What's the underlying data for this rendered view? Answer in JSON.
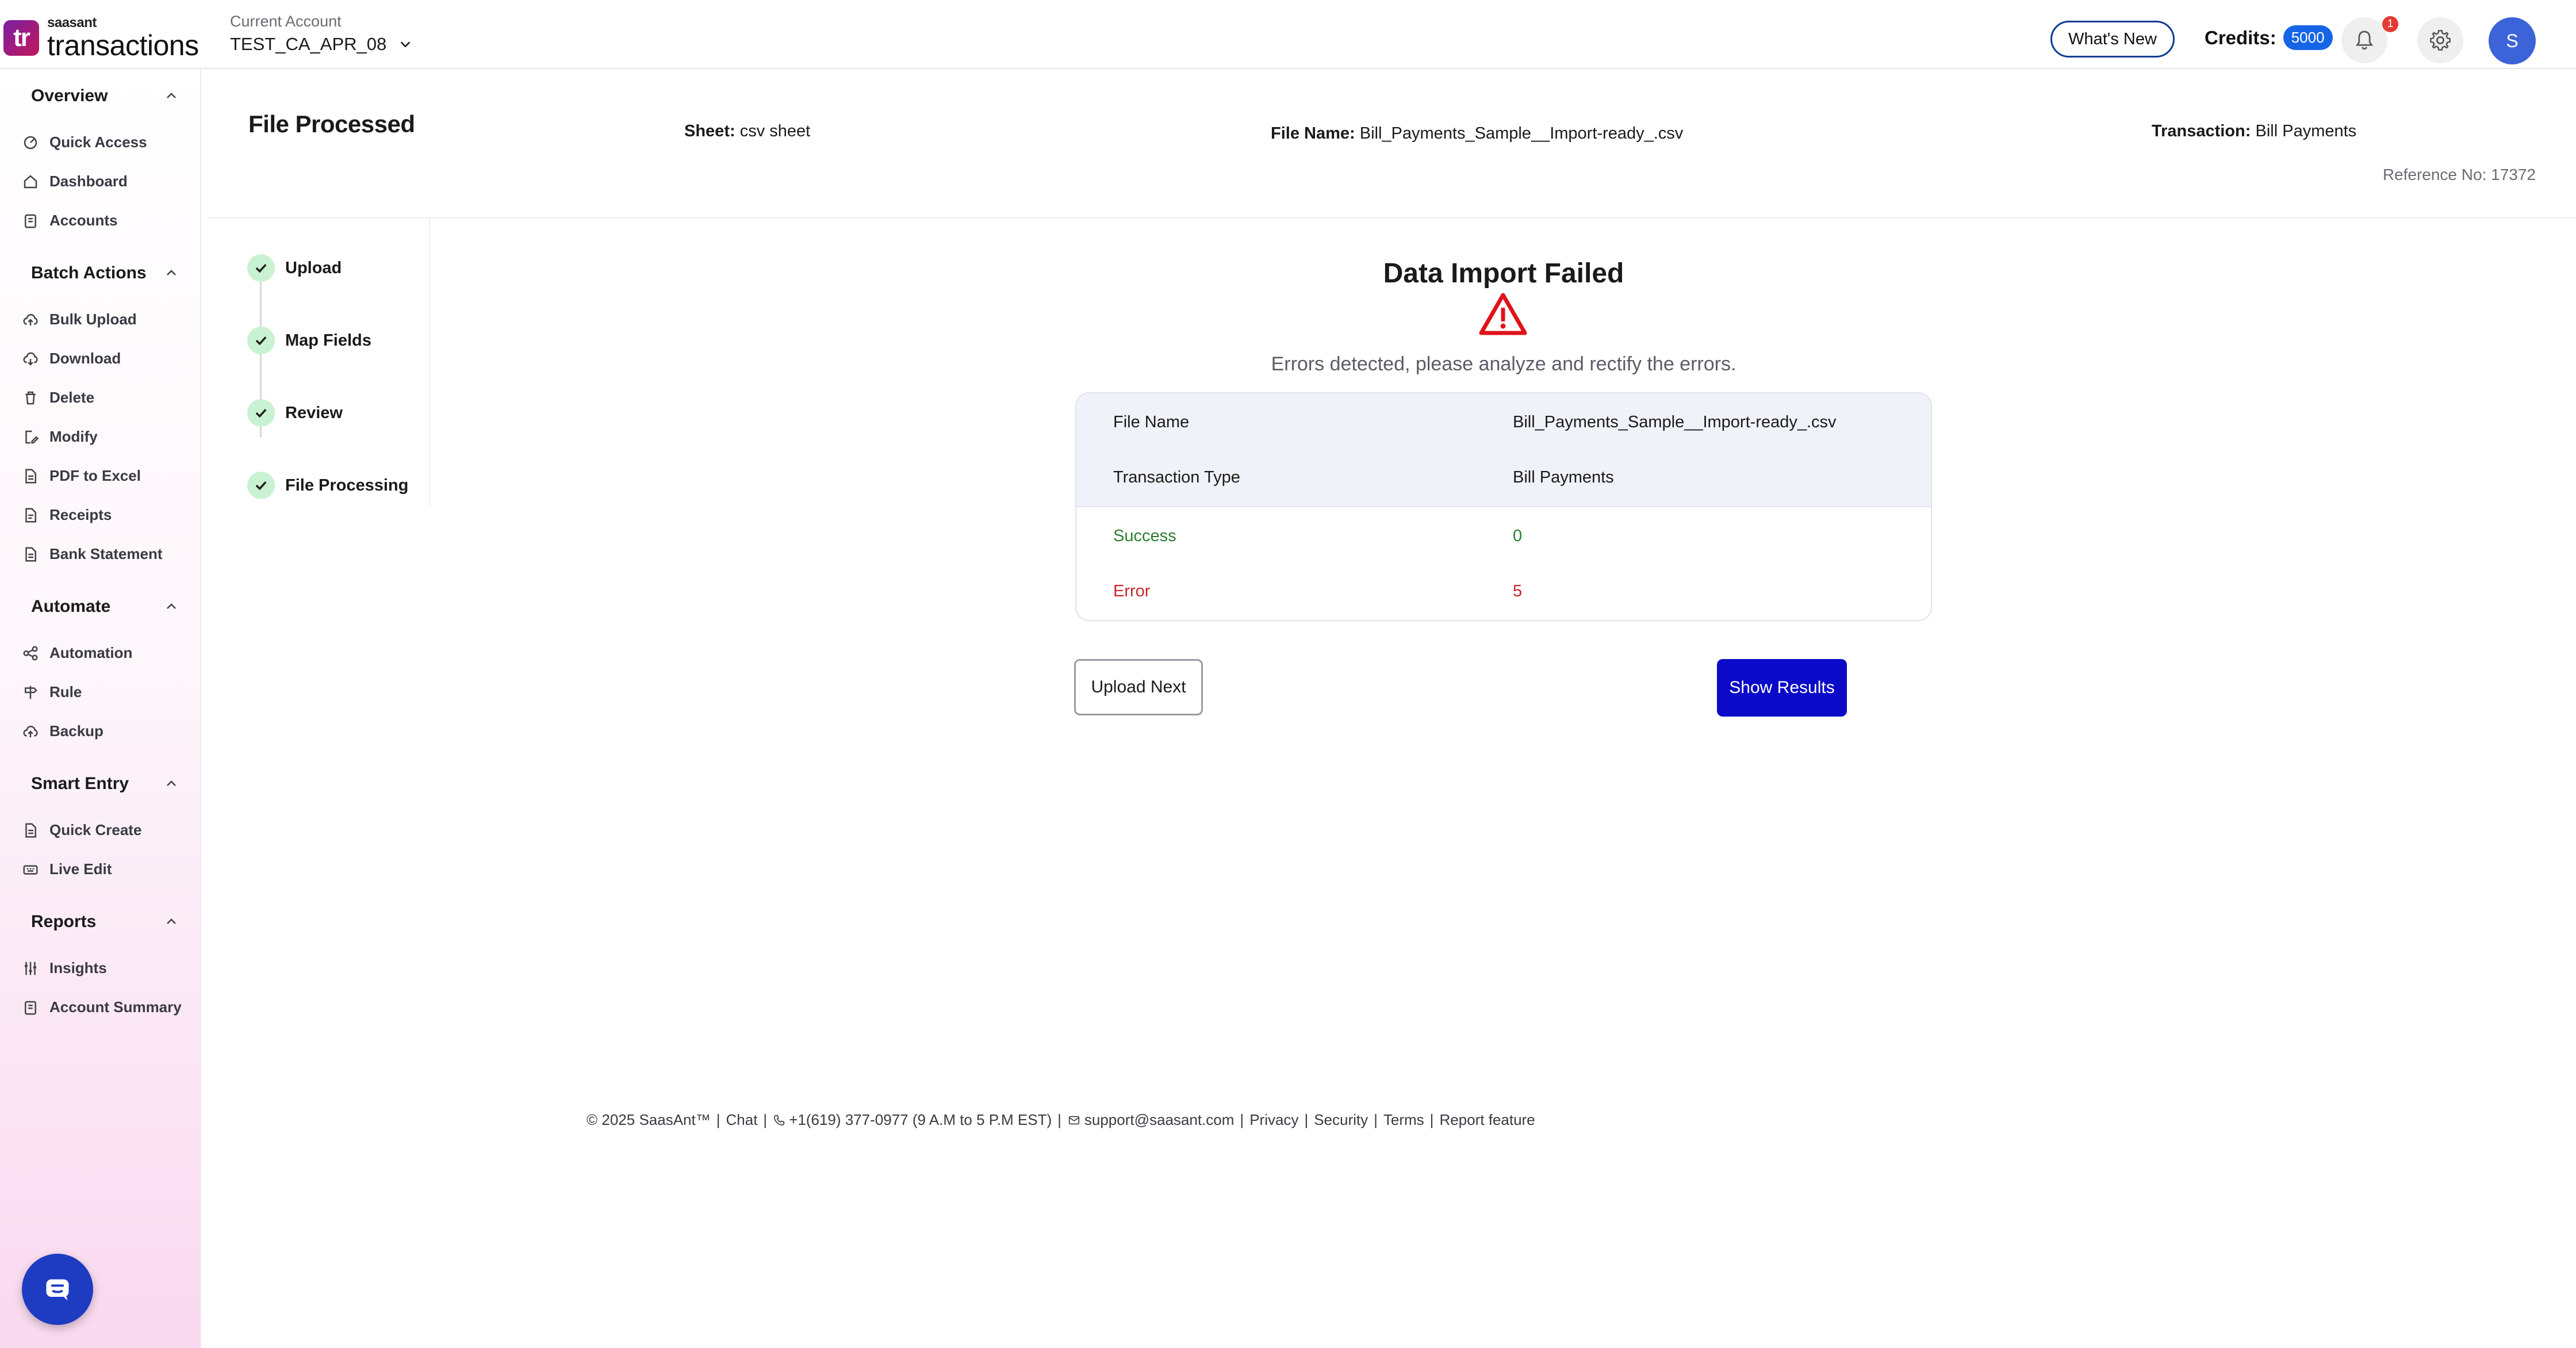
{
  "app": {
    "logo_small": "saasant",
    "logo_big": "transactions",
    "logo_mark": "tr"
  },
  "header": {
    "account_label": "Current Account",
    "account_value": "TEST_CA_APR_08",
    "whats_new": "What's New",
    "credits_label": "Credits:",
    "credits_value": "5000",
    "notification_count": "1",
    "avatar_initial": "S"
  },
  "sidebar": {
    "sections": [
      {
        "title": "Overview",
        "items": [
          "Quick Access",
          "Dashboard",
          "Accounts"
        ]
      },
      {
        "title": "Batch Actions",
        "items": [
          "Bulk Upload",
          "Download",
          "Delete",
          "Modify",
          "PDF to Excel",
          "Receipts",
          "Bank Statement"
        ]
      },
      {
        "title": "Automate",
        "items": [
          "Automation",
          "Rule",
          "Backup"
        ]
      },
      {
        "title": "Smart Entry",
        "items": [
          "Quick Create",
          "Live Edit"
        ]
      },
      {
        "title": "Reports",
        "items": [
          "Insights",
          "Account Summary"
        ]
      }
    ]
  },
  "page": {
    "title": "File Processed",
    "sheet_label": "Sheet:",
    "sheet_value": "csv sheet",
    "file_label": "File Name:",
    "file_value": "Bill_Payments_Sample__Import-ready_.csv",
    "transaction_label": "Transaction:",
    "transaction_value": "Bill Payments",
    "reference": "Reference No: 17372"
  },
  "steps": [
    "Upload",
    "Map Fields",
    "Review",
    "File Processing"
  ],
  "result": {
    "title": "Data Import Failed",
    "subtitle": "Errors detected, please analyze and rectify the errors.",
    "file_name_label": "File Name",
    "file_name_value": "Bill_Payments_Sample__Import-ready_.csv",
    "transaction_type_label": "Transaction Type",
    "transaction_type_value": "Bill Payments",
    "success_label": "Success",
    "success_value": "0",
    "error_label": "Error",
    "error_value": "5",
    "upload_next": "Upload Next",
    "show_results": "Show Results"
  },
  "footer": {
    "copyright": "© 2025 SaasAnt™",
    "chat": "Chat",
    "phone": "+1(619) 377-0977 (9 A.M to 5 P.M EST)",
    "email": "support@saasant.com",
    "privacy": "Privacy",
    "security": "Security",
    "terms": "Terms",
    "report": "Report feature"
  },
  "colors": {
    "primary": "#0a0ac8",
    "success": "#2e7d32",
    "error": "#c62828",
    "brand": "#7a1fa2"
  },
  "icons": [
    "chevron-down-icon",
    "bell-icon",
    "gear-icon",
    "chevron-up-icon",
    "warning-icon",
    "check-icon",
    "chat-icon"
  ]
}
